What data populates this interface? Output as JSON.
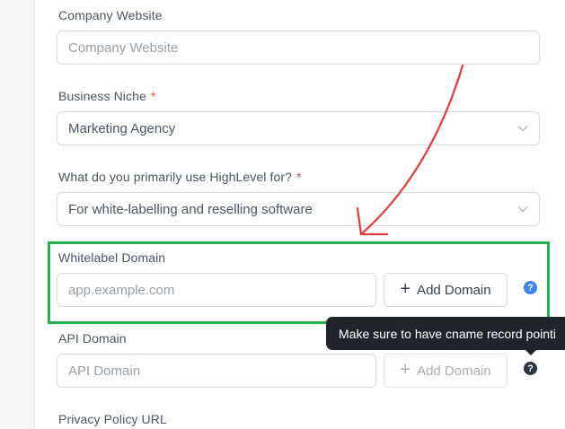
{
  "form": {
    "company_website": {
      "label": "Company Website",
      "placeholder": "Company Website"
    },
    "business_niche": {
      "label": "Business Niche",
      "required_mark": "*",
      "value": "Marketing Agency"
    },
    "primary_use": {
      "label": "What do you primarily use HighLevel for?",
      "required_mark": "*",
      "value": "For white-labelling and reselling software"
    },
    "whitelabel_domain": {
      "label": "Whitelabel Domain",
      "placeholder": "app.example.com",
      "button_label": "Add Domain",
      "help_glyph": "?"
    },
    "api_domain": {
      "label": "API Domain",
      "placeholder": "API Domain",
      "button_label": "Add Domain",
      "help_glyph": "?"
    },
    "privacy_policy": {
      "label": "Privacy Policy URL"
    }
  },
  "tooltip": {
    "text": "Make sure to have cname record pointi"
  },
  "annotations": {
    "highlight_color": "#22b14c",
    "arrow_color": "#e53935"
  },
  "icons": {
    "plus": "+",
    "dropdown": "chevron-down-icon",
    "help": "question-circle-icon"
  }
}
